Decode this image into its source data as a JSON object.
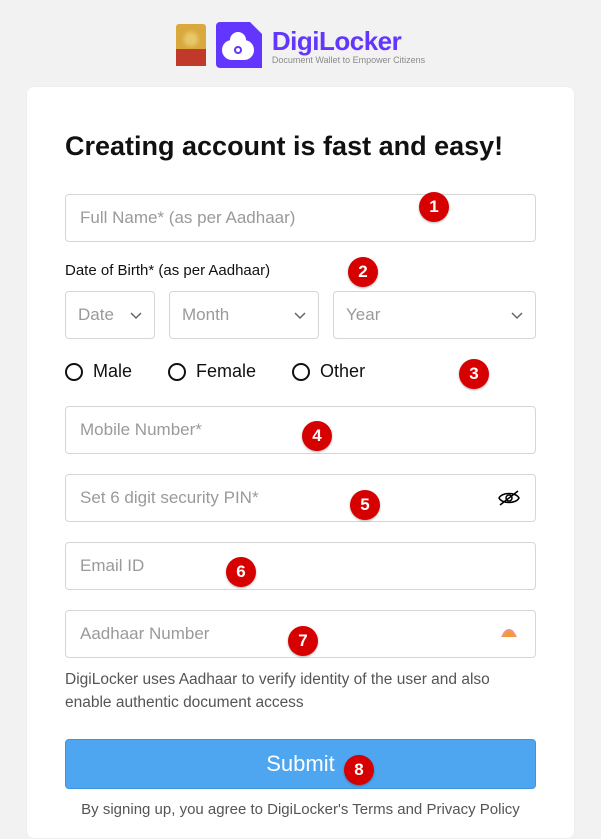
{
  "brand": {
    "name": "DigiLocker",
    "tagline": "Document Wallet to Empower Citizens"
  },
  "form": {
    "heading": "Creating account is fast and easy!",
    "full_name_placeholder": "Full Name* (as per Aadhaar)",
    "dob_label": "Date of Birth* (as per Aadhaar)",
    "dob_date": "Date",
    "dob_month": "Month",
    "dob_year": "Year",
    "gender": {
      "male": "Male",
      "female": "Female",
      "other": "Other"
    },
    "mobile_placeholder": "Mobile Number*",
    "pin_placeholder": "Set 6 digit security PIN*",
    "email_placeholder": "Email ID",
    "aadhaar_placeholder": "Aadhaar Number",
    "aadhaar_help": "DigiLocker uses Aadhaar to verify identity of the user and also enable authentic document access",
    "submit_label": "Submit",
    "terms_text": "By signing up, you agree to DigiLocker's Terms and Privacy Policy"
  },
  "annotations": {
    "n1": "1",
    "n2": "2",
    "n3": "3",
    "n4": "4",
    "n5": "5",
    "n6": "6",
    "n7": "7",
    "n8": "8"
  }
}
